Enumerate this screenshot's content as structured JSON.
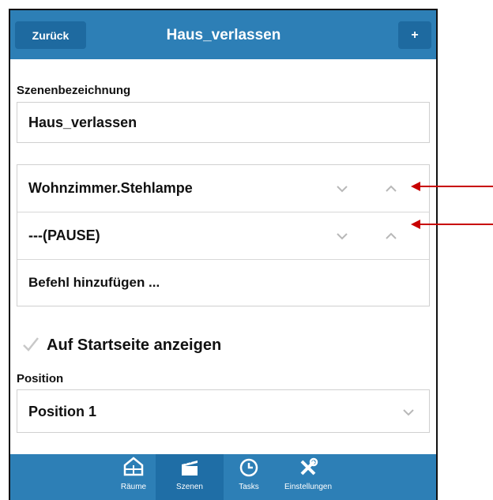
{
  "header": {
    "back_label": "Zurück",
    "title": "Haus_verlassen",
    "add_label": "+"
  },
  "scene_name": {
    "label": "Szenenbezeichnung",
    "value": "Haus_verlassen"
  },
  "commands": [
    {
      "label": "Wohnzimmer.Stehlampe"
    },
    {
      "label": "---(PAUSE)"
    }
  ],
  "add_command_label": "Befehl hinzufügen ...",
  "show_on_start": {
    "label": "Auf Startseite anzeigen",
    "checked": true
  },
  "position": {
    "label": "Position",
    "value": "Position 1"
  },
  "tabs": [
    {
      "label": "Räume",
      "icon": "rooms-icon"
    },
    {
      "label": "Szenen",
      "icon": "scenes-icon",
      "active": true
    },
    {
      "label": "Tasks",
      "icon": "clock-icon"
    },
    {
      "label": "Einstellungen",
      "icon": "tools-icon"
    }
  ],
  "colors": {
    "accent": "#2d7fb6",
    "accent_dark": "#1e6aa0",
    "annotation": "#c80000"
  }
}
